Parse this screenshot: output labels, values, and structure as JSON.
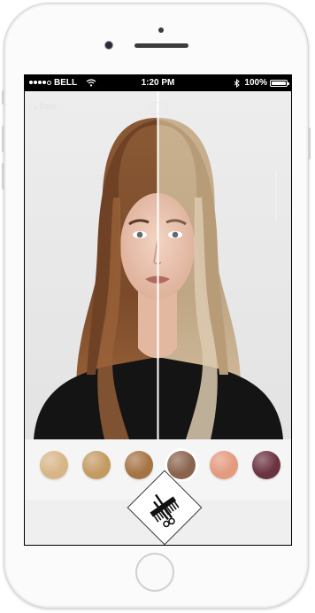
{
  "status": {
    "carrier": "BELL",
    "time": "1:20 PM",
    "battery": "100%",
    "signal_bars_filled": 4,
    "signal_bars_total": 5
  },
  "appbar": {
    "back_label": "Back",
    "back_icon": "chevron-left-icon",
    "edit_icon": "edit-icon"
  },
  "photo": {
    "mode": "before-after split",
    "left_hair_color": "#7a4a2a",
    "right_hair_color": "#cdb79a"
  },
  "swatches": [
    {
      "color": "#d8b587",
      "selected": false
    },
    {
      "color": "#c49a63",
      "selected": false
    },
    {
      "color": "#a57444",
      "selected": false
    },
    {
      "color": "#8a634d",
      "selected": true
    },
    {
      "color": "#e39a7e",
      "selected": false
    },
    {
      "color": "#6a3340",
      "selected": false
    }
  ],
  "logo": {
    "icon": "comb-scissors-icon"
  }
}
